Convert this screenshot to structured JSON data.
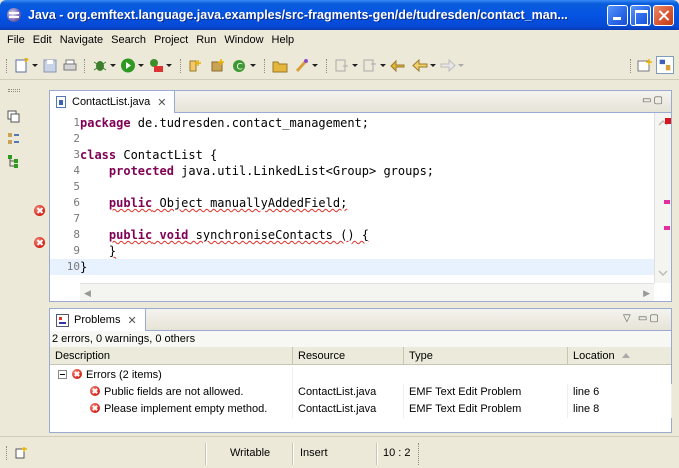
{
  "window": {
    "title": "Java - org.emftext.language.java.examples/src-fragments-gen/de/tudresden/contact_man...",
    "icon": "eclipse-icon"
  },
  "menu": [
    "File",
    "Edit",
    "Navigate",
    "Search",
    "Project",
    "Run",
    "Window",
    "Help"
  ],
  "editor": {
    "tab_label": "ContactList.java",
    "tab_close": "✕",
    "code_lines": [
      {
        "number": "1",
        "text": "package de.tudresden.contact_management;"
      },
      {
        "number": "2",
        "text": ""
      },
      {
        "number": "3",
        "text": "class ContactList {"
      },
      {
        "number": "4",
        "text": "    protected java.util.LinkedList<Group> groups;"
      },
      {
        "number": "5",
        "text": ""
      },
      {
        "number": "6",
        "text": "    public Object manuallyAddedField;"
      },
      {
        "number": "7",
        "text": ""
      },
      {
        "number": "8",
        "text": "    public void synchroniseContacts () {"
      },
      {
        "number": "9",
        "text": "    }"
      },
      {
        "number": "10",
        "text": "}"
      }
    ]
  },
  "problems": {
    "tab_label": "Problems",
    "tab_close": "✕",
    "summary": "2 errors, 0 warnings, 0 others",
    "columns": [
      "Description",
      "Resource",
      "Type",
      "Location"
    ],
    "group_label": "Errors (2 items)",
    "rows": [
      {
        "description": "Public fields are not allowed.",
        "resource": "ContactList.java",
        "type": "EMF Text Edit Problem",
        "location": "line 6"
      },
      {
        "description": "Please implement empty method.",
        "resource": "ContactList.java",
        "type": "EMF Text Edit Problem",
        "location": "line 8"
      }
    ]
  },
  "status": {
    "writable": "Writable",
    "insert_mode": "Insert",
    "cursor": "10 : 2"
  },
  "colors": {
    "keyword": "#7f0055",
    "error": "#d41f14",
    "titlebar": "#0554e3",
    "current_line": "#e8f2fe"
  }
}
